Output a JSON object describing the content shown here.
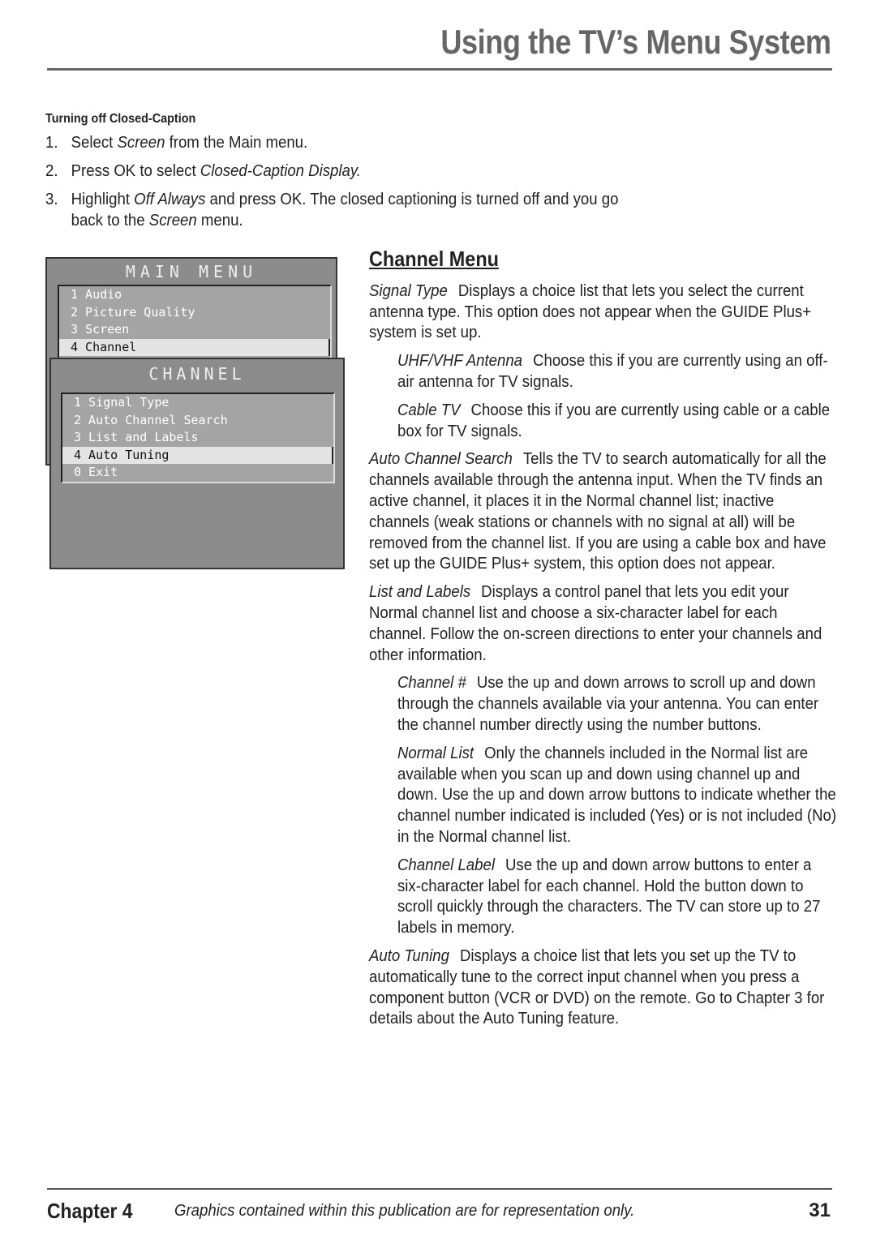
{
  "header": {
    "title": "Using the TV’s Menu System"
  },
  "closed_caption": {
    "heading": "Turning off Closed-Caption",
    "steps": [
      {
        "num": "1.",
        "parts": [
          "Select ",
          "Screen",
          " from the Main menu."
        ]
      },
      {
        "num": "2.",
        "parts": [
          "Press OK to select ",
          "Closed-Caption Display.",
          ""
        ]
      },
      {
        "num": "3.",
        "parts": [
          "Highlight ",
          "Off Always",
          " and press OK. The closed captioning is turned off and you go back to the ",
          "Screen",
          " menu."
        ]
      }
    ]
  },
  "tv_menu": {
    "main": {
      "title": "MAIN MENU",
      "items": [
        "1 Audio",
        "2 Picture Quality",
        "3 Screen",
        "4 Channel"
      ],
      "selected": "4 Channel"
    },
    "channel": {
      "title": "CHANNEL",
      "items": [
        "1 Signal Type",
        "2 Auto Channel Search",
        "3 List and Labels",
        "4 Auto Tuning",
        "0 Exit"
      ],
      "selected": "4 Auto Tuning"
    }
  },
  "channel_menu": {
    "title": "Channel Menu",
    "entries": [
      {
        "term": "Signal Type",
        "text": "Displays a choice list that lets you select the current antenna type. This option does not appear when the GUIDE Plus+ system is set up.",
        "level": 0
      },
      {
        "term": "UHF/VHF Antenna",
        "text": "Choose this if you are currently using an off-air antenna for TV signals.",
        "level": 1
      },
      {
        "term": "Cable TV",
        "text": "Choose this if you are currently using cable or a cable box for TV signals.",
        "level": 1
      },
      {
        "term": "Auto Channel Search",
        "text": "Tells the TV to search automatically for all the channels available through the antenna input. When the TV finds an active channel, it places it in the Normal channel list; inactive channels (weak stations or channels with no signal at all) will be removed from the channel list. If you are using a cable box and have set up the GUIDE Plus+ system, this option does not appear.",
        "level": 0
      },
      {
        "term": "List and Labels",
        "text": "Displays a control panel that lets you edit your Normal channel list and choose a six-character label for each channel. Follow the on-screen directions to enter your channels and other information.",
        "level": 0
      },
      {
        "term": "Channel #",
        "text": "Use the up and down arrows to scroll up and down through the channels available via your antenna. You can enter the channel number directly using the number buttons.",
        "level": 1
      },
      {
        "term": "Normal List",
        "text": "Only the channels included in the Normal list are available when you scan up and down using channel up and down. Use the up and down arrow buttons to indicate whether the channel number indicated is included (Yes) or is not included (No) in the Normal channel list.",
        "level": 1
      },
      {
        "term": "Channel Label",
        "text": "Use the up and down arrow buttons to enter a six-character label for each channel. Hold the button down to scroll quickly through the characters. The TV can store up to 27 labels in memory.",
        "level": 1
      },
      {
        "term": "Auto Tuning",
        "text": "Displays a choice list that lets you set up the TV to automatically tune to the correct input channel when you press a component button (VCR or DVD) on the remote. Go to Chapter 3 for details about the Auto Tuning feature.",
        "level": 0
      }
    ]
  },
  "footer": {
    "chapter": "Chapter 4",
    "disclaimer": "Graphics contained within this publication are for representation only.",
    "page": "31"
  }
}
